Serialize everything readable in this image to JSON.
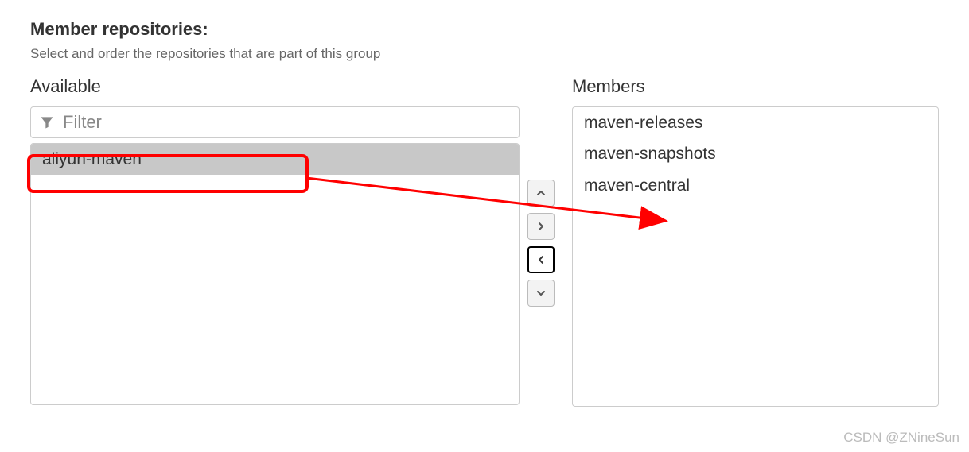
{
  "section": {
    "title": "Member repositories:",
    "description": "Select and order the repositories that are part of this group"
  },
  "available": {
    "label": "Available",
    "filter_placeholder": "Filter",
    "items": [
      {
        "label": "aliyun-maven",
        "selected": true
      }
    ]
  },
  "members": {
    "label": "Members",
    "items": [
      {
        "label": "maven-releases"
      },
      {
        "label": "maven-snapshots"
      },
      {
        "label": "maven-central"
      }
    ]
  },
  "watermark": "CSDN @ZNineSun"
}
